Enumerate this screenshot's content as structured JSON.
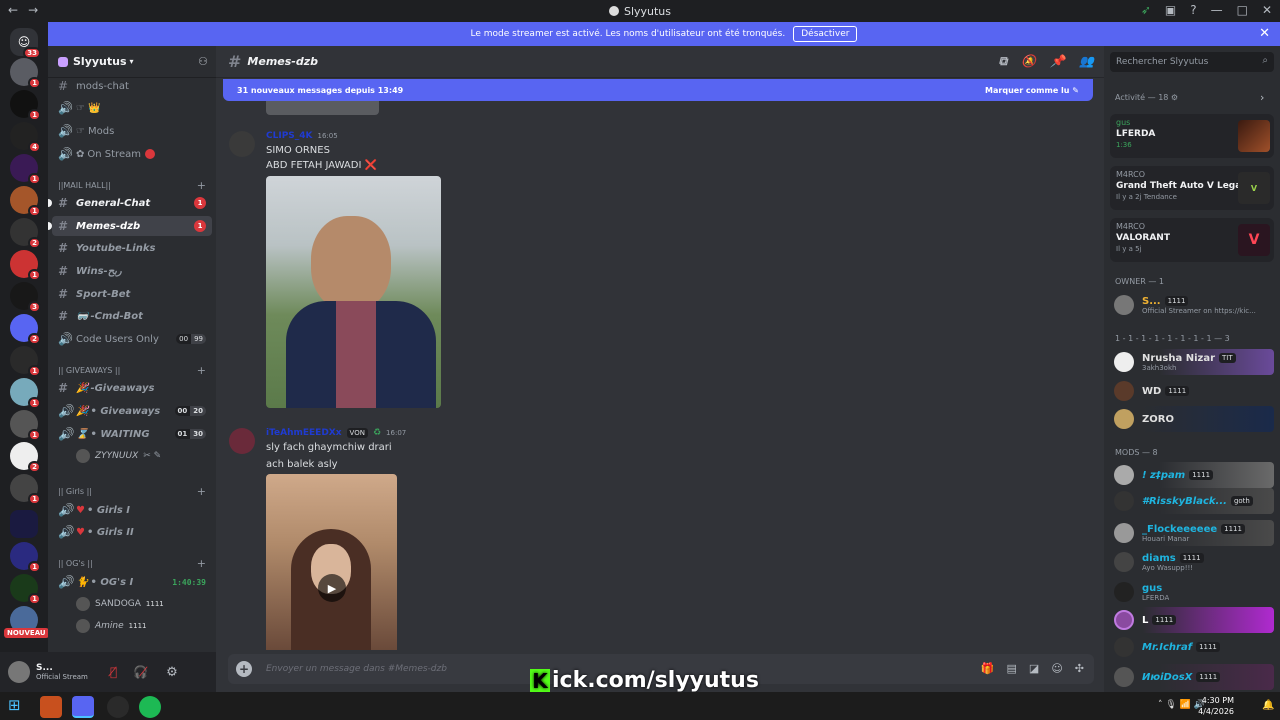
{
  "window": {
    "title": "Slyyutus"
  },
  "banner": {
    "text": "Le mode streamer est activé. Les noms d'utilisateur ont été tronqués.",
    "button": "Désactiver"
  },
  "rail": {
    "badges": [
      "33",
      "1",
      "1",
      "4",
      "1",
      "1",
      "2",
      "1",
      "3",
      "2",
      "1",
      "1",
      "1",
      "2",
      "1",
      "1",
      "1"
    ],
    "new_label": "NOUVEAU"
  },
  "guild": {
    "name": "Slyyutus"
  },
  "channels": {
    "mods_chat": "mods-chat",
    "crown": "👑",
    "mods": "Mods",
    "on_stream": "On Stream",
    "cat_mail": "||MAIL HALL||",
    "general": "General-Chat",
    "general_badge": "1",
    "memes": "Memes-dzb",
    "memes_badge": "1",
    "youtube": "Youtube-Links",
    "wins": "Wins-ربح",
    "sport": "Sport-Bet",
    "cmd": "-Cmd-Bot",
    "code_users": "Code Users Only",
    "code_count": [
      "00",
      "99"
    ],
    "cat_giveaways": "|| GIVEAWAYS ||",
    "giveaways": "-Giveaways",
    "giveaways_voice": "• Giveaways",
    "giveaways_count": [
      "00",
      "20"
    ],
    "waiting": "• WAITING",
    "waiting_count": [
      "01",
      "30"
    ],
    "waiting_user": "ZYYNUUX",
    "cat_girls": "|| Girls ||",
    "girls1": "• Girls I",
    "girls2": "• Girls II",
    "cat_ogs": "|| OG's ||",
    "ogs": "• OG's I",
    "ogs_timer": "1:40:39",
    "og_user1": "SANDOGA",
    "og_user2": "Amine",
    "og_tag": "1111"
  },
  "userpanel": {
    "name": "S...",
    "status": "Official Stream"
  },
  "header": {
    "channel": "Memes-dzb"
  },
  "newbar": {
    "text": "31 nouveaux messages depuis 13:49",
    "mark": "Marquer comme lu"
  },
  "messages": [
    {
      "author": "CLIPS_4K",
      "time": "16:05",
      "lines": [
        "SIMO ORNES",
        "ABD FETAH JAWADI ❌"
      ],
      "color": "#1f3bd1"
    },
    {
      "author": "iTeAhmEEEDXx",
      "tag": "VON",
      "time": "16:07",
      "lines": [
        "sly fach ghaymchiw drari",
        "ach balek asly"
      ],
      "color": "#1f3bd1"
    }
  ],
  "composer": {
    "placeholder": "Envoyer un message dans #Memes-dzb"
  },
  "overlay": {
    "kick": "ick.com/slyyutus",
    "k": "K"
  },
  "search": {
    "placeholder": "Rechercher Slyyutus"
  },
  "activity": {
    "title": "Activité — 18",
    "cards": [
      {
        "who": "gus",
        "what": "LFERDA",
        "sub": "1:36"
      },
      {
        "who": "M4RCO",
        "what": "Grand Theft Auto V Legacy",
        "sub": "Il y a 2j   Tendance"
      },
      {
        "who": "M4RCO",
        "what": "VALORANT",
        "sub": "Il y a 5j"
      }
    ]
  },
  "members": {
    "owner_title": "OWNER — 1",
    "owner": [
      {
        "name": "S...",
        "tag": "1111",
        "status": "Official Streamer on https://kic..."
      }
    ],
    "group_title": "1 - 1 - 1 - 1 - 1 - 1 - 1 - 1 — 3",
    "group": [
      {
        "name": "Nrusha Nizar",
        "tag": "TIT",
        "status": "3akh3okh"
      },
      {
        "name": "WD",
        "tag": "1111",
        "status": ""
      },
      {
        "name": "ZORO",
        "tag": "",
        "status": ""
      }
    ],
    "mods_title": "MODS — 8",
    "mods": [
      {
        "name": "! z‡pam",
        "tag": "1111",
        "status": ""
      },
      {
        "name": "#RisskyBlack...",
        "tag": "goth",
        "status": ""
      },
      {
        "name": "_Flockeeeeee",
        "tag": "1111",
        "status": "Houari Manar"
      },
      {
        "name": "diams",
        "tag": "1111",
        "status": "Ayo Wasupp!!!"
      },
      {
        "name": "gus",
        "tag": "",
        "status": "LFERDA"
      },
      {
        "name": "L",
        "tag": "1111",
        "status": ""
      },
      {
        "name": "Mr.Ichraf",
        "tag": "1111",
        "status": ""
      },
      {
        "name": "ИюiDosX",
        "tag": "1111",
        "status": ""
      }
    ]
  },
  "clock": {
    "time": "4:30 PM",
    "date": "4/4/2026"
  }
}
